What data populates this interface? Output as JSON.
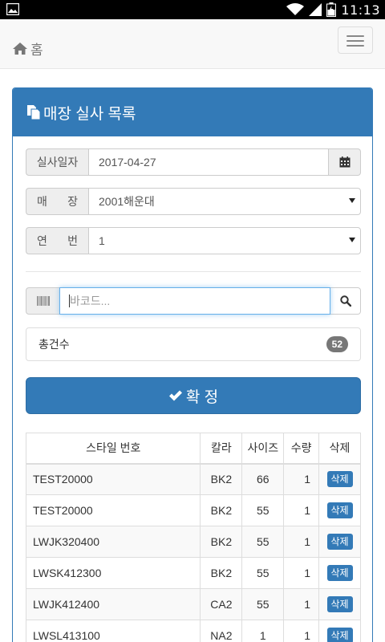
{
  "status_bar": {
    "time": "11:13",
    "icons": [
      "image-icon",
      "wifi-icon",
      "signal-icon",
      "battery-icon"
    ]
  },
  "navbar": {
    "home_label": "홈",
    "home_icon": "home-icon",
    "menu_icon": "hamburger-menu-icon"
  },
  "panel": {
    "title": "매장 실사 목록",
    "title_icon": "copy-icon"
  },
  "form": {
    "date_label": "실사일자",
    "date_value": "2017-04-27",
    "store_label_a": "매",
    "store_label_b": "장",
    "store_value": "2001해운대",
    "seq_label_a": "연",
    "seq_label_b": "번",
    "seq_value": "1",
    "barcode_placeholder": "바코드..."
  },
  "summary": {
    "total_label": "총건수",
    "total_count": "52"
  },
  "confirm_label": "확 정",
  "table": {
    "headers": [
      "스타일 번호",
      "칼라",
      "사이즈",
      "수량",
      "삭제"
    ],
    "rows": [
      {
        "style": "TEST20000",
        "color": "BK2",
        "size": "66",
        "qty": "1",
        "del": "삭제"
      },
      {
        "style": "TEST20000",
        "color": "BK2",
        "size": "55",
        "qty": "1",
        "del": "삭제"
      },
      {
        "style": "LWJK320400",
        "color": "BK2",
        "size": "55",
        "qty": "1",
        "del": "삭제"
      },
      {
        "style": "LWSK412300",
        "color": "BK2",
        "size": "55",
        "qty": "1",
        "del": "삭제"
      },
      {
        "style": "LWJK412400",
        "color": "CA2",
        "size": "55",
        "qty": "1",
        "del": "삭제"
      },
      {
        "style": "LWSL413100",
        "color": "NA2",
        "size": "1",
        "qty": "1",
        "del": "삭제"
      }
    ]
  },
  "colors": {
    "primary": "#337ab7",
    "badge": "#777777"
  }
}
